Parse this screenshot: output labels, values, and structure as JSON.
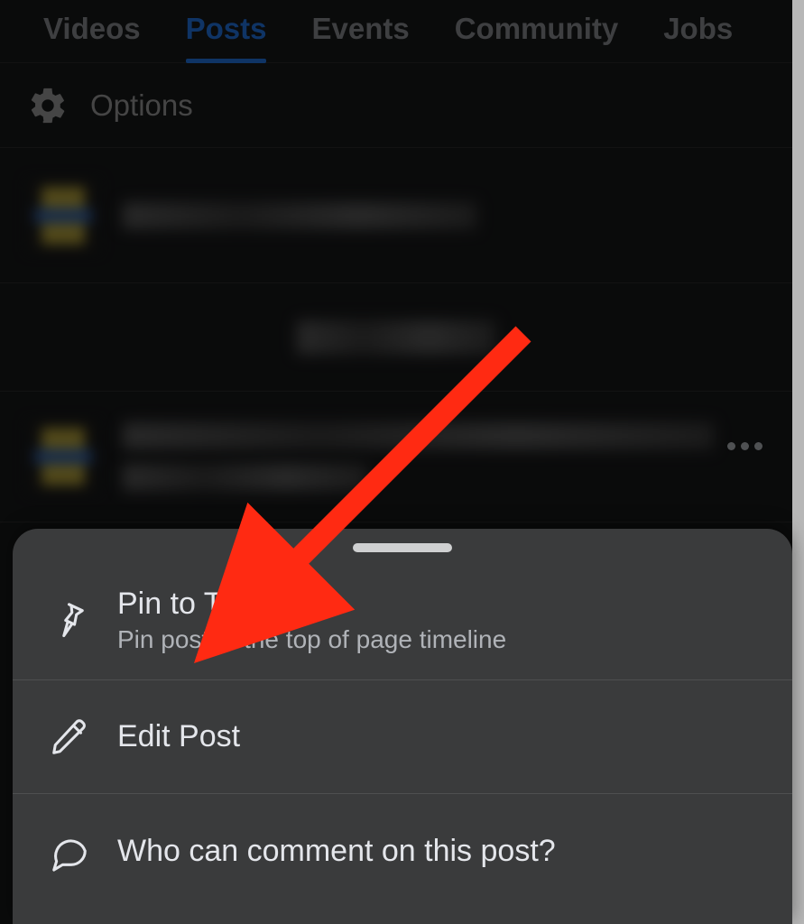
{
  "tabs": {
    "videos": "Videos",
    "posts": "Posts",
    "events": "Events",
    "community": "Community",
    "jobs": "Jobs",
    "active": "posts"
  },
  "options": {
    "label": "Options"
  },
  "sheet": {
    "pin": {
      "title": "Pin to Top",
      "subtitle": "Pin post to the top of page timeline"
    },
    "edit": {
      "title": "Edit Post"
    },
    "comment": {
      "title": "Who can comment on this post?"
    }
  }
}
